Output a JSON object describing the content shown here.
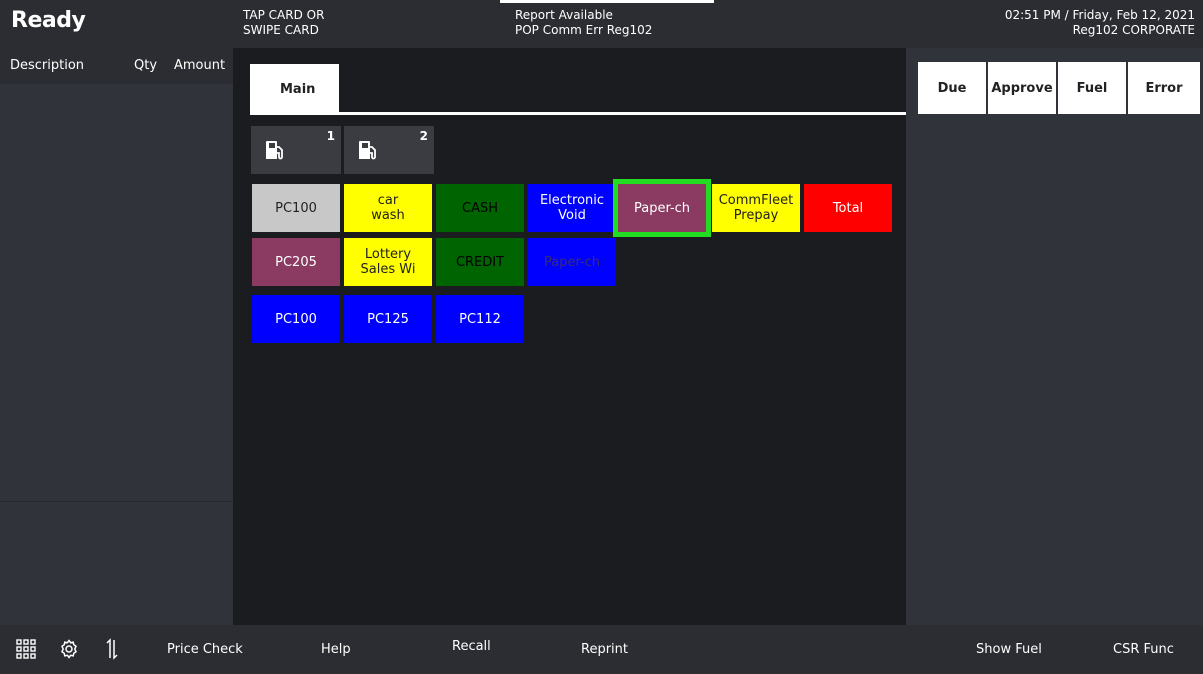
{
  "header": {
    "status": "Ready",
    "prompt_line1": "TAP CARD OR",
    "prompt_line2": "SWIPE CARD",
    "message_line1": "Report Available",
    "message_line2": "POP Comm Err Reg102",
    "datetime": "02:51 PM / Friday, Feb 12, 2021",
    "register": "Reg102  CORPORATE"
  },
  "transaction": {
    "columns": [
      "Description",
      "Qty",
      "Amount"
    ]
  },
  "tabs": {
    "main": "Main"
  },
  "pumps": [
    {
      "number": "1",
      "icon": "fuel-pump-icon"
    },
    {
      "number": "2",
      "icon": "fuel-pump-icon"
    }
  ],
  "grid_buttons": {
    "pc100_a": "PC100",
    "car_wash_1": "car",
    "car_wash_2": "wash",
    "cash": "CASH",
    "evoid_1": "Electronic",
    "evoid_2": "Void",
    "paper_ch_a": "Paper-ch",
    "commfleet_1": "CommFleet",
    "commfleet_2": "Prepay",
    "total": "Total",
    "pc205": "PC205",
    "lottery_1": "Lottery",
    "lottery_2": "Sales Wi",
    "credit": "CREDIT",
    "paper_ch_b": "Paper-ch",
    "pc100_b": "PC100",
    "pc125": "PC125",
    "pc112": "PC112"
  },
  "colors": {
    "gray": "#c8c8c8",
    "yellow": "#ffff00",
    "green": "#006400",
    "blue": "#0000ff",
    "mauve": "#8b3a62",
    "red": "#ff0000",
    "selection": "#22dd22"
  },
  "right_panel": {
    "due": "Due",
    "approve": "Approve",
    "fuel": "Fuel",
    "error": "Error"
  },
  "footer": {
    "icons": [
      "grid-menu-icon",
      "settings-gear-icon",
      "vertical-arrows-icon"
    ],
    "price_check": "Price Check",
    "help": "Help",
    "recall": "Recall",
    "reprint": "Reprint",
    "show_fuel": "Show Fuel",
    "csr_func": "CSR Func"
  }
}
